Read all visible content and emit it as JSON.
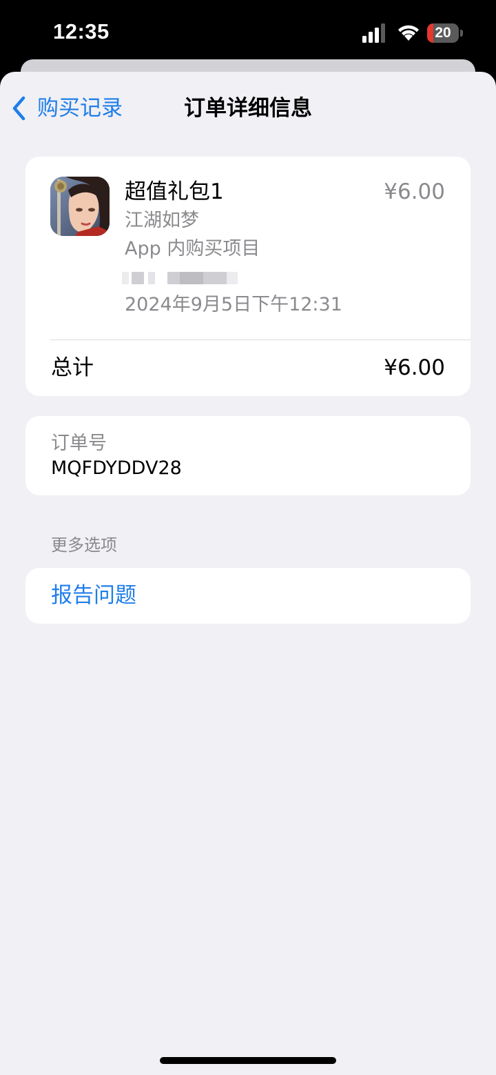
{
  "status_bar": {
    "time": "12:35",
    "battery_level": "20",
    "battery_fraction": 0.2,
    "icons": [
      "cellular-signal-icon",
      "wifi-icon",
      "battery-icon"
    ]
  },
  "nav": {
    "back_label": "购买记录",
    "title": "订单详细信息"
  },
  "product": {
    "icon": "app-icon-jianghu-rumeng",
    "name": "超值礼包1",
    "price": "¥6.00",
    "app_name": "江湖如梦",
    "purchase_type": "App 内购买项目",
    "date": "2024年9月5日下午12:31"
  },
  "total": {
    "label": "总计",
    "value": "¥6.00"
  },
  "order": {
    "label": "订单号",
    "value": "MQFDYDDV28"
  },
  "more_options": {
    "header": "更多选项",
    "report_label": "报告问题"
  },
  "colors": {
    "accent": "#1f7ee8",
    "background": "#f0f0f5",
    "secondary_text": "#8a8a8e",
    "battery_low": "#e5372e"
  }
}
